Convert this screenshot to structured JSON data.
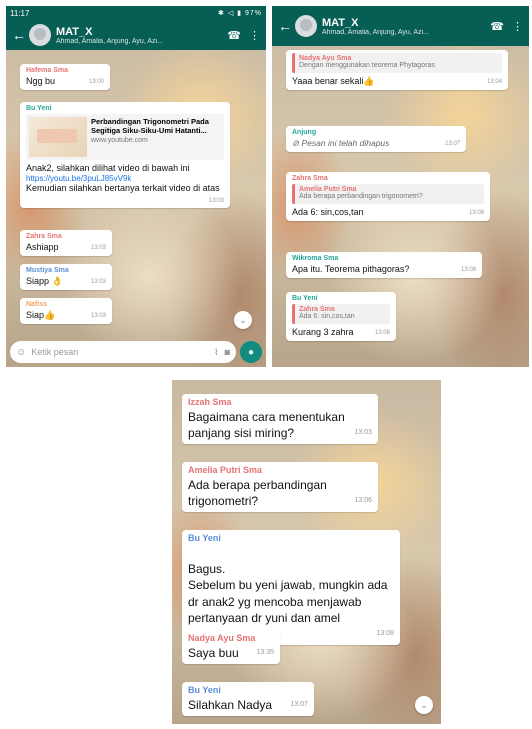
{
  "chat": {
    "title": "MAT_X",
    "subtitle": "Ahmad, Amalia, Anjung, Ayu, Azi...",
    "status_time": "11:17",
    "status_right": "97%",
    "input_placeholder": "Ketik pesan",
    "icons": [
      "back-arrow-icon",
      "group-avatar",
      "add-call-icon",
      "menu-icon",
      "emoji-icon",
      "attach-icon",
      "camera-icon",
      "mic-icon",
      "scroll-down-icon",
      "deleted-icon"
    ]
  },
  "panel1": {
    "messages": [
      {
        "sender": "Hafema Sma",
        "text": "Ngg bu",
        "time": "13:00"
      },
      {
        "sender": "Bu Yeni",
        "card_title": "Perbandingan Trigonometri Pada Segitiga Siku-Siku-Umi Hatanti...",
        "card_domain": "www.youtube.com",
        "text": "Anak2, silahkan dilihat video di bawah ini",
        "link": "https://youtu.be/3puLJ85vV9k",
        "text2": "Kemudian silahkan bertanya terkait video di atas",
        "time": "13:03"
      },
      {
        "sender": "Zahra Sma",
        "text": "Ashiapp",
        "time": "13:03"
      },
      {
        "sender": "Mustiya Sma",
        "text": "Siapp 👌",
        "time": "13:03"
      },
      {
        "sender": "Nafiss",
        "text": "Siap👍",
        "time": "13:03"
      }
    ]
  },
  "panel2": {
    "messages": [
      {
        "quote_sender": "Nadya Ayu Sma",
        "quote_text": "Dengan menggunakan teorema Phytagoras",
        "text": "Yaaa benar sekali👍",
        "time": "13:04"
      },
      {
        "sender": "Anjung",
        "deleted": "Pesan ini telah dihapus",
        "time": "13:07"
      },
      {
        "sender": "Zahra Sma",
        "quote_sender": "Amelia Putri Sma",
        "quote_text": "Ada berapa perbandingan trigonometri?",
        "text": "Ada 6: sin,cos,tan",
        "time": "13:08"
      },
      {
        "sender": "Wikroma Sma",
        "text": "Apa itu. Teorema pithagoras?",
        "time": "13:08"
      },
      {
        "sender": "Bu Yeni",
        "quote_sender": "Zahra Sma",
        "quote_text": "Ada 6: sin,cos,tan",
        "text": "Kurang 3 zahra",
        "time": "13:08"
      }
    ]
  },
  "panel3": {
    "messages": [
      {
        "sender": "Izzah Sma",
        "text": "Bagaimana cara menentukan panjang sisi miring?",
        "time": "13:03"
      },
      {
        "sender": "Amelia Putri Sma",
        "text": "Ada berapa perbandingan trigonometri?",
        "time": "13:06"
      },
      {
        "sender": "Bu Yeni",
        "text": "Bagus.\nSebelum bu yeni jawab, mungkin ada dr anak2 yg mencoba menjawab pertanyaan dr yuni dan amel",
        "time": "13:08"
      },
      {
        "sender": "Nadya Ayu Sma",
        "text": "Saya buu",
        "time": "13:35"
      },
      {
        "sender": "Bu Yeni",
        "text": "Silahkan Nadya",
        "time": "13:07"
      }
    ]
  },
  "colors": {
    "header": "#075e54",
    "accent": "#128c7e",
    "sender_pink": "#e57373",
    "sender_teal": "#26a69a",
    "sender_blue": "#5c8fd6",
    "sender_orange": "#f4a261"
  }
}
